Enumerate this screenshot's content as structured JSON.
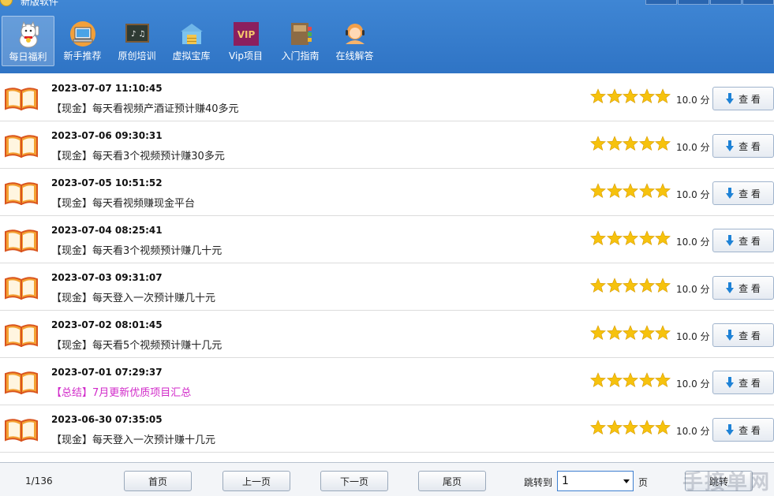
{
  "window": {
    "title": "新版软件"
  },
  "toolbar": [
    {
      "label": "每日福利",
      "icon": "lucky-cat-icon",
      "active": true
    },
    {
      "label": "新手推荐",
      "icon": "monitor-icon",
      "active": false
    },
    {
      "label": "原创培训",
      "icon": "blackboard-icon",
      "active": false
    },
    {
      "label": "虚拟宝库",
      "icon": "warehouse-icon",
      "active": false
    },
    {
      "label": "Vip项目",
      "icon": "vip-icon",
      "active": false
    },
    {
      "label": "入门指南",
      "icon": "guidebook-icon",
      "active": false
    },
    {
      "label": "在线解答",
      "icon": "support-agent-icon",
      "active": false
    }
  ],
  "vip_text": "VIP",
  "items": [
    {
      "date": "2023-07-07 11:10:45",
      "title": "【现金】每天看视频产酒证预计赚40多元",
      "rating": 5,
      "score": "10.0 分",
      "button": "查 看",
      "highlight": false
    },
    {
      "date": "2023-07-06 09:30:31",
      "title": "【现金】每天看3个视频预计赚30多元",
      "rating": 5,
      "score": "10.0 分",
      "button": "查 看",
      "highlight": false
    },
    {
      "date": "2023-07-05 10:51:52",
      "title": "【现金】每天看视频赚现金平台",
      "rating": 5,
      "score": "10.0 分",
      "button": "查 看",
      "highlight": false
    },
    {
      "date": "2023-07-04 08:25:41",
      "title": "【现金】每天看3个视频预计赚几十元",
      "rating": 5,
      "score": "10.0 分",
      "button": "查 看",
      "highlight": false
    },
    {
      "date": "2023-07-03 09:31:07",
      "title": "【现金】每天登入一次预计赚几十元",
      "rating": 5,
      "score": "10.0 分",
      "button": "查 看",
      "highlight": false
    },
    {
      "date": "2023-07-02 08:01:45",
      "title": "【现金】每天看5个视频预计赚十几元",
      "rating": 5,
      "score": "10.0 分",
      "button": "查 看",
      "highlight": false
    },
    {
      "date": "2023-07-01 07:29:37",
      "title": "【总结】7月更新优质项目汇总",
      "rating": 5,
      "score": "10.0 分",
      "button": "查 看",
      "highlight": true
    },
    {
      "date": "2023-06-30 07:35:05",
      "title": "【现金】每天登入一次预计赚十几元",
      "rating": 5,
      "score": "10.0 分",
      "button": "查 看",
      "highlight": false
    }
  ],
  "colors": {
    "toolbar_bg": "#3079c9",
    "highlight_text": "#d12ac9",
    "star": "#f6c20d"
  },
  "pagination": {
    "info": "1/136",
    "first": "首页",
    "prev": "上一页",
    "next": "下一页",
    "last": "尾页",
    "jump_label": "跳转到",
    "jump_value": "1",
    "page_unit": "页",
    "go": "跳转"
  },
  "watermark": "手接单网"
}
